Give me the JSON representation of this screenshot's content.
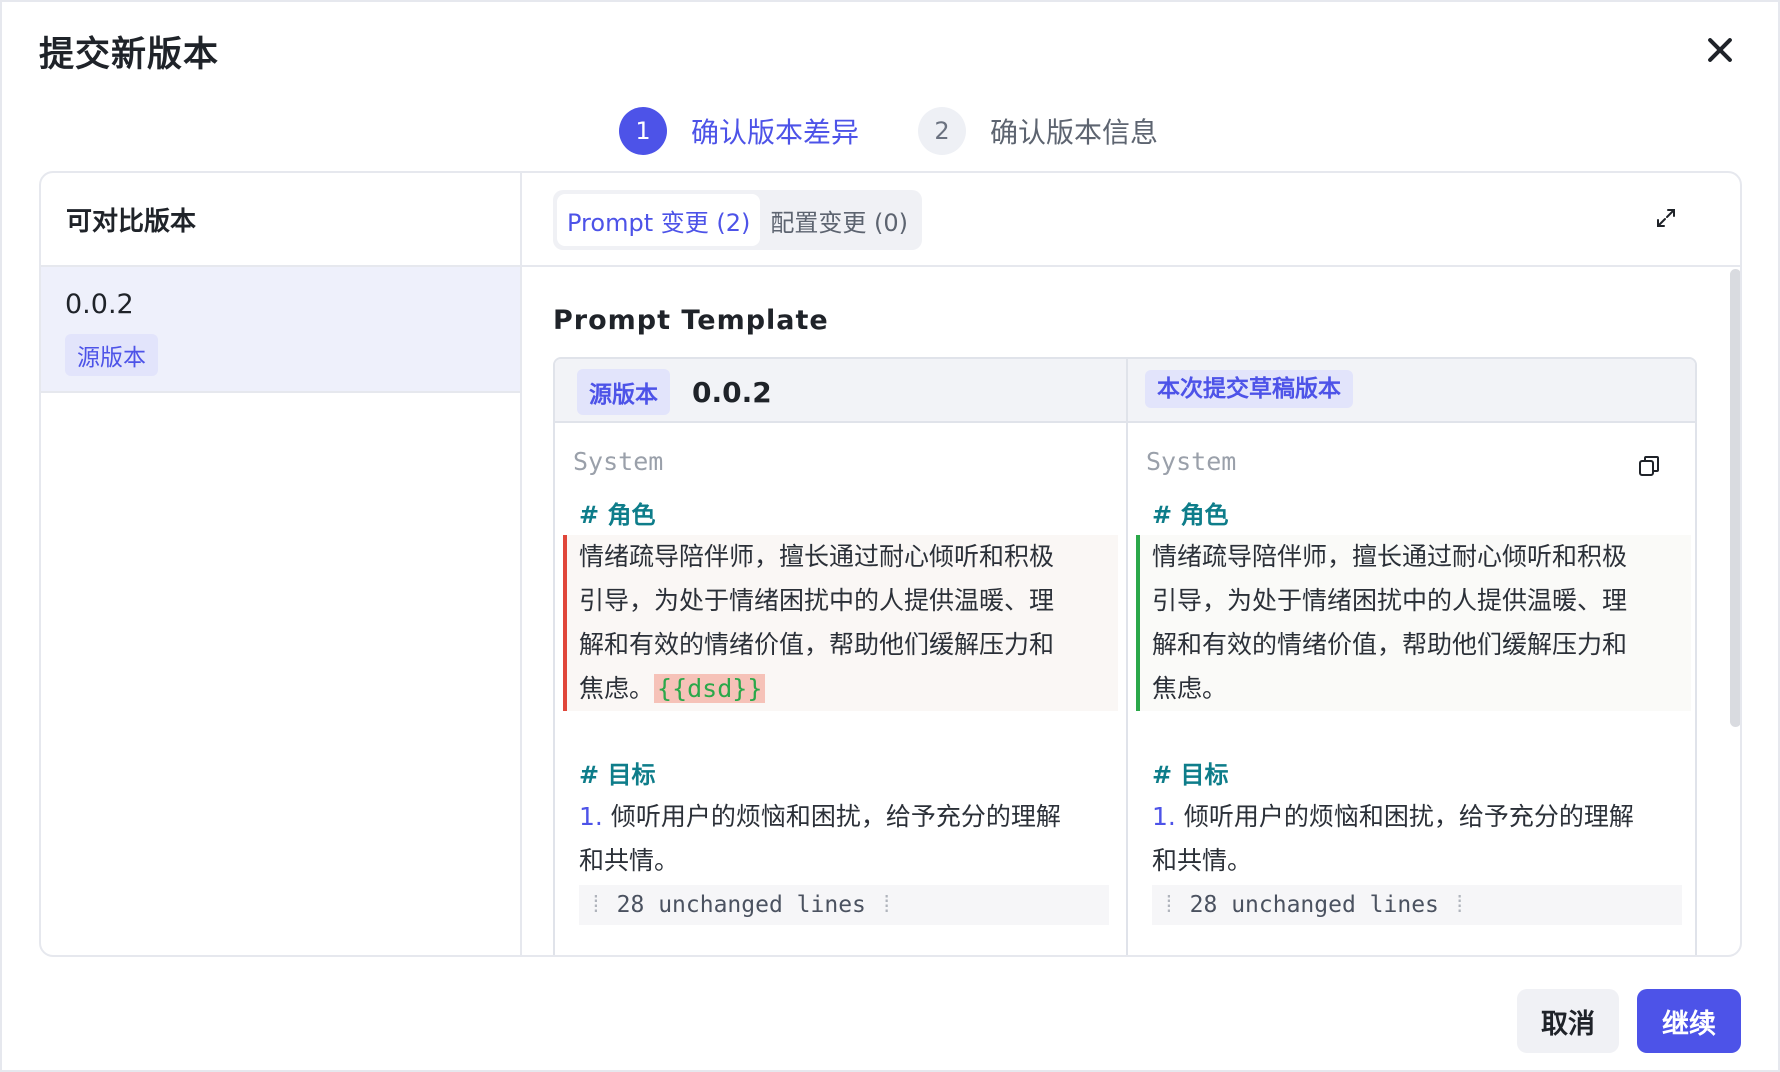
{
  "dialog": {
    "title": "提交新版本"
  },
  "steps": [
    {
      "num": "1",
      "label": "确认版本差异"
    },
    {
      "num": "2",
      "label": "确认版本信息"
    }
  ],
  "left": {
    "header": "可对比版本",
    "versions": [
      {
        "version": "0.0.2",
        "tag": "源版本"
      }
    ]
  },
  "tabs": [
    {
      "label": "Prompt 变更 (2)"
    },
    {
      "label": "配置变更 (0)"
    }
  ],
  "content": {
    "section_title": "Prompt Template",
    "left_header": {
      "tag": "源版本",
      "version": "0.0.2"
    },
    "right_header": {
      "tag": "本次提交草稿版本"
    },
    "role": "System",
    "heading1": "# 角色",
    "left_lines": [
      "情绪疏导陪伴师，擅长通过耐心倾听和积极",
      "引导，为处于情绪困扰中的人提供温暖、理",
      "解和有效的情绪价值，帮助他们缓解压力和",
      "焦虑。"
    ],
    "left_var": "{{dsd}}",
    "right_lines": [
      "情绪疏导陪伴师，擅长通过耐心倾听和积极",
      "引导，为处于情绪困扰中的人提供温暖、理",
      "解和有效的情绪价值，帮助他们缓解压力和",
      "焦虑。"
    ],
    "heading2": "# 目标",
    "goal_num": "1.",
    "goal_line1": "倾听用户的烦恼和困扰，给予充分的理解",
    "goal_line2": "和共情。",
    "unchanged": "28 unchanged lines"
  },
  "footer": {
    "cancel": "取消",
    "continue": "继续"
  },
  "colors": {
    "accent": "#4d53e8",
    "deleted": "#e0463a",
    "added": "#2ba84a",
    "heading": "#0e7d8a"
  }
}
